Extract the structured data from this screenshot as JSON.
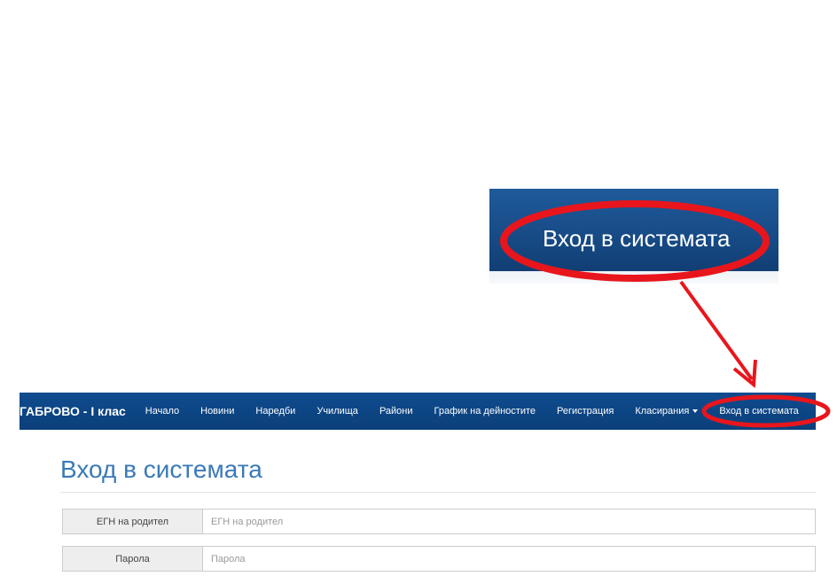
{
  "navbar": {
    "brand": "ГАБРОВО - I клас",
    "items": [
      {
        "label": "Начало"
      },
      {
        "label": "Новини"
      },
      {
        "label": "Наредби"
      },
      {
        "label": "Училища"
      },
      {
        "label": "Райони"
      },
      {
        "label": "График на дейностите"
      },
      {
        "label": "Регистрация"
      },
      {
        "label": "Класирания"
      },
      {
        "label": "Вход в системата"
      }
    ]
  },
  "zoom": {
    "label": "Вход в системата"
  },
  "main": {
    "title": "Вход в системата",
    "form": {
      "egn_label": "ЕГН на родител",
      "egn_placeholder": "ЕГН на родител",
      "password_label": "Парола",
      "password_placeholder": "Парола"
    }
  },
  "colors": {
    "navbar": "#0f4c8f",
    "title": "#3a7ab6",
    "annotation": "#e8161c"
  }
}
